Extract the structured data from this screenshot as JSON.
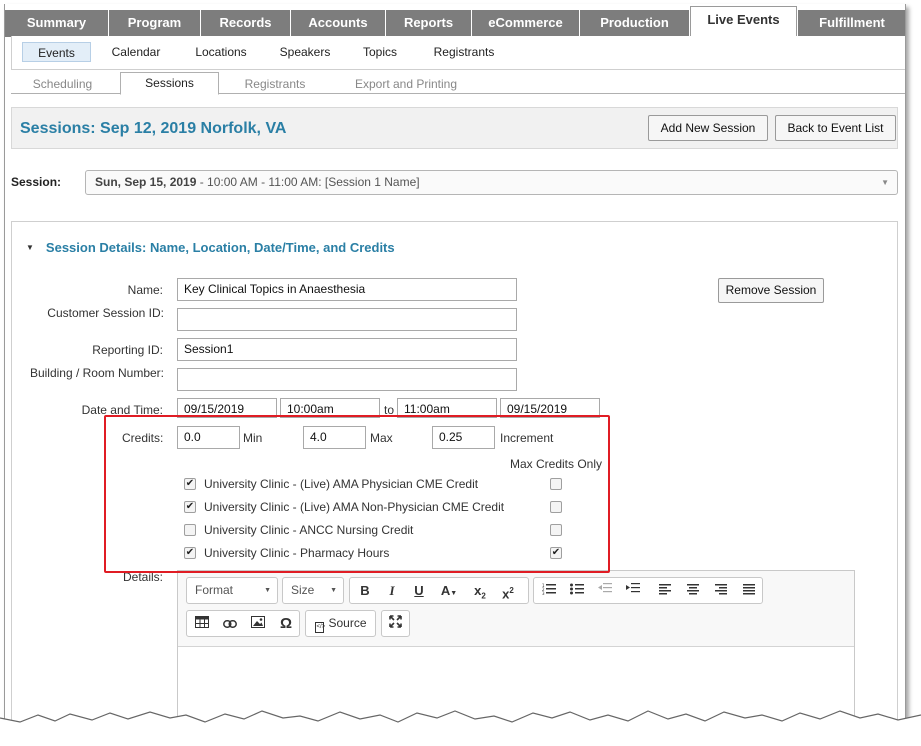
{
  "main_tabs": [
    "Summary",
    "Program",
    "Records",
    "Accounts",
    "Reports",
    "eCommerce",
    "Production",
    "Live Events",
    "Fulfillment"
  ],
  "active_main_tab": "Live Events",
  "sub_nav": [
    "Events",
    "Calendar",
    "Locations",
    "Speakers",
    "Topics",
    "Registrants"
  ],
  "active_sub_nav": "Events",
  "section_tabs": [
    "Scheduling",
    "Sessions",
    "Registrants",
    "Export and Printing"
  ],
  "active_section_tab": "Sessions",
  "header": {
    "title": "Sessions: Sep 12, 2019 Norfolk, VA",
    "add_button": "Add New Session",
    "back_button": "Back to Event List"
  },
  "session": {
    "label": "Session:",
    "selected_bold": "Sun, Sep 15, 2019",
    "selected_rest": " - 10:00 AM - 11:00 AM: [Session 1 Name]"
  },
  "details": {
    "heading": "Session Details: Name, Location, Date/Time, and Credits",
    "remove_button": "Remove Session",
    "name_label": "Name:",
    "name_value": "Key Clinical Topics in Anaesthesia",
    "customer_id_label": "Customer Session ID:",
    "customer_id_value": "",
    "reporting_id_label": "Reporting ID:",
    "reporting_id_value": "Session1",
    "building_label": "Building / Room Number:",
    "building_value": "",
    "datetime_label": "Date and Time:",
    "start_date": "09/15/2019",
    "start_time": "10:00am",
    "to_label": "to",
    "end_time": "11:00am",
    "end_date": "09/15/2019",
    "credits_label": "Credits:",
    "min_value": "0.0",
    "min_label": "Min",
    "max_value": "4.0",
    "max_label": "Max",
    "increment_value": "0.25",
    "increment_label": "Increment",
    "max_credits_only_label": "Max Credits Only",
    "credit_types": [
      {
        "label": "University Clinic - (Live) AMA Physician CME Credit",
        "checked": true,
        "max_only": false
      },
      {
        "label": "University Clinic - (Live) AMA Non-Physician CME Credit",
        "checked": true,
        "max_only": false
      },
      {
        "label": "University Clinic - ANCC Nursing Credit",
        "checked": false,
        "max_only": false
      },
      {
        "label": "University Clinic - Pharmacy Hours",
        "checked": true,
        "max_only": true
      }
    ],
    "details_label": "Details:"
  },
  "editor": {
    "format_label": "Format",
    "size_label": "Size",
    "source_label": "Source"
  },
  "colors": {
    "accent": "#2a7fa5",
    "tab_gray": "#7d7d7d",
    "highlight_red": "#e01c24"
  }
}
